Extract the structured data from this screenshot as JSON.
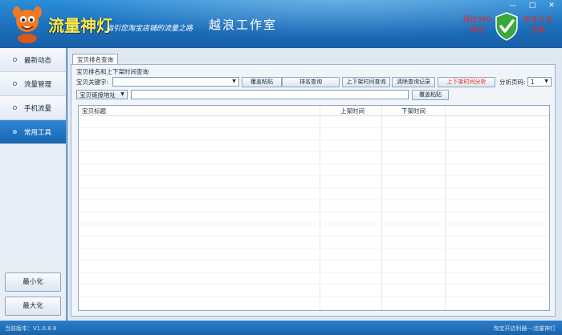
{
  "header": {
    "app_title": "流量神灯",
    "slogan": "指引您淘宝店铺的流量之路",
    "studio_name": "越浪工作室",
    "security_left": [
      "通过360",
      "保证"
    ],
    "security_right": [
      "安全认证",
      "无毒"
    ],
    "window_controls": [
      "—",
      "□",
      "✕"
    ]
  },
  "sidebar": {
    "items": [
      {
        "label": "最新动态",
        "active": false
      },
      {
        "label": "流量管理",
        "active": false
      },
      {
        "label": "手机流量",
        "active": false
      },
      {
        "label": "常用工具",
        "active": true
      }
    ],
    "minimize_label": "最小化",
    "maximize_label": "最大化"
  },
  "main": {
    "tab_label": "宝贝排名查询",
    "section_title": "宝贝排名和上下架时间查询",
    "keyword_label": "宝贝关键字:",
    "keyword_value": "",
    "buttons": {
      "paste1": "覆盖粘贴",
      "rank_query": "排名查询",
      "shelf_query": "上下架时间查询",
      "clear_records": "清除查询记录",
      "shelf_analysis": "上下架时间分析"
    },
    "page_label": "分析页码:",
    "page_value": "1",
    "link_select": "宝贝链接地址",
    "link_value": "",
    "paste2": "覆盖粘贴",
    "table_headers": [
      "宝贝标题",
      "上架时间",
      "下架时间"
    ]
  },
  "statusbar": {
    "version": "当前版本：V1.0.8.8",
    "footer": "淘宝开店利器---流量神灯"
  },
  "colors": {
    "header_blue": "#1d70bd",
    "title_yellow": "#ffe94a",
    "alert_red": "#e8261d",
    "active_nav": "#1b65b0"
  }
}
